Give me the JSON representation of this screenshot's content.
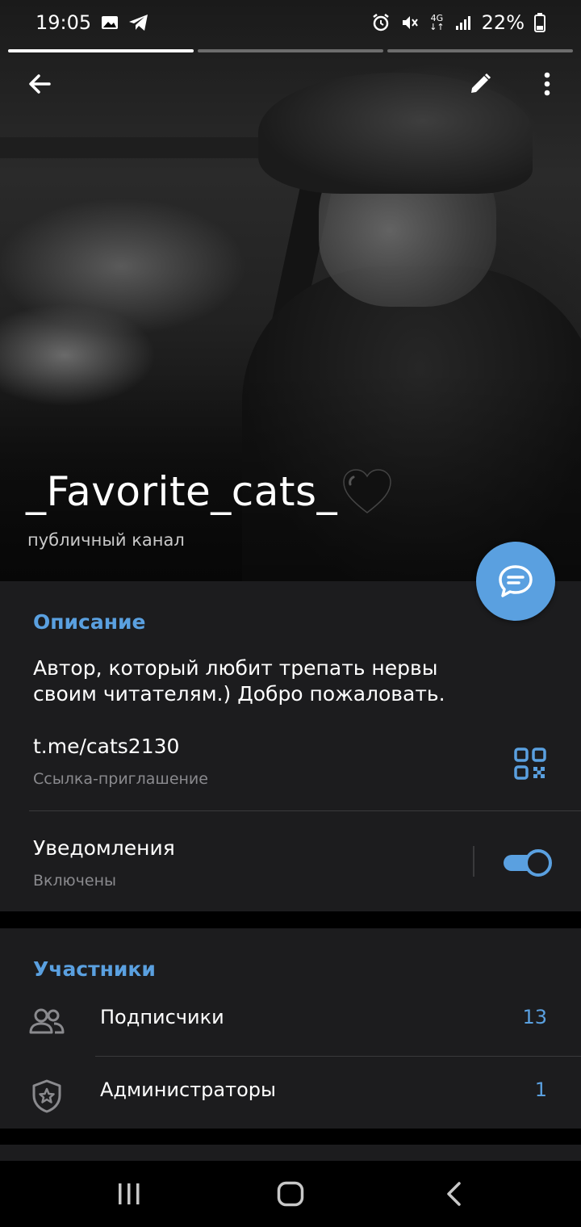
{
  "status_bar": {
    "time": "19:05",
    "battery": "22%",
    "network": "4G",
    "icons": [
      "image-icon",
      "telegram-icon",
      "alarm-icon",
      "mute-icon",
      "signal-icon",
      "battery-icon"
    ]
  },
  "story_bars": {
    "count": 3,
    "active_index": 0
  },
  "header": {
    "channel_name": "_Favorite_cats_",
    "heart_emoji": "🖤",
    "channel_type": "публичный канал"
  },
  "info": {
    "section_title": "Описание",
    "description": "Автор, который любит трепать нервы своим читателям.) Добро пожаловать.",
    "link": "t.me/cats2130",
    "link_caption": "Ссылка-приглашение",
    "notifications_label": "Уведомления",
    "notifications_status": "Включены",
    "notifications_on": true
  },
  "members": {
    "section_title": "Участники",
    "subscribers_label": "Подписчики",
    "subscribers_count": "13",
    "admins_label": "Администраторы",
    "admins_count": "1"
  },
  "colors": {
    "accent": "#5aa0e0",
    "card_bg": "#1c1c1e",
    "secondary_text": "#8a8a8e"
  }
}
